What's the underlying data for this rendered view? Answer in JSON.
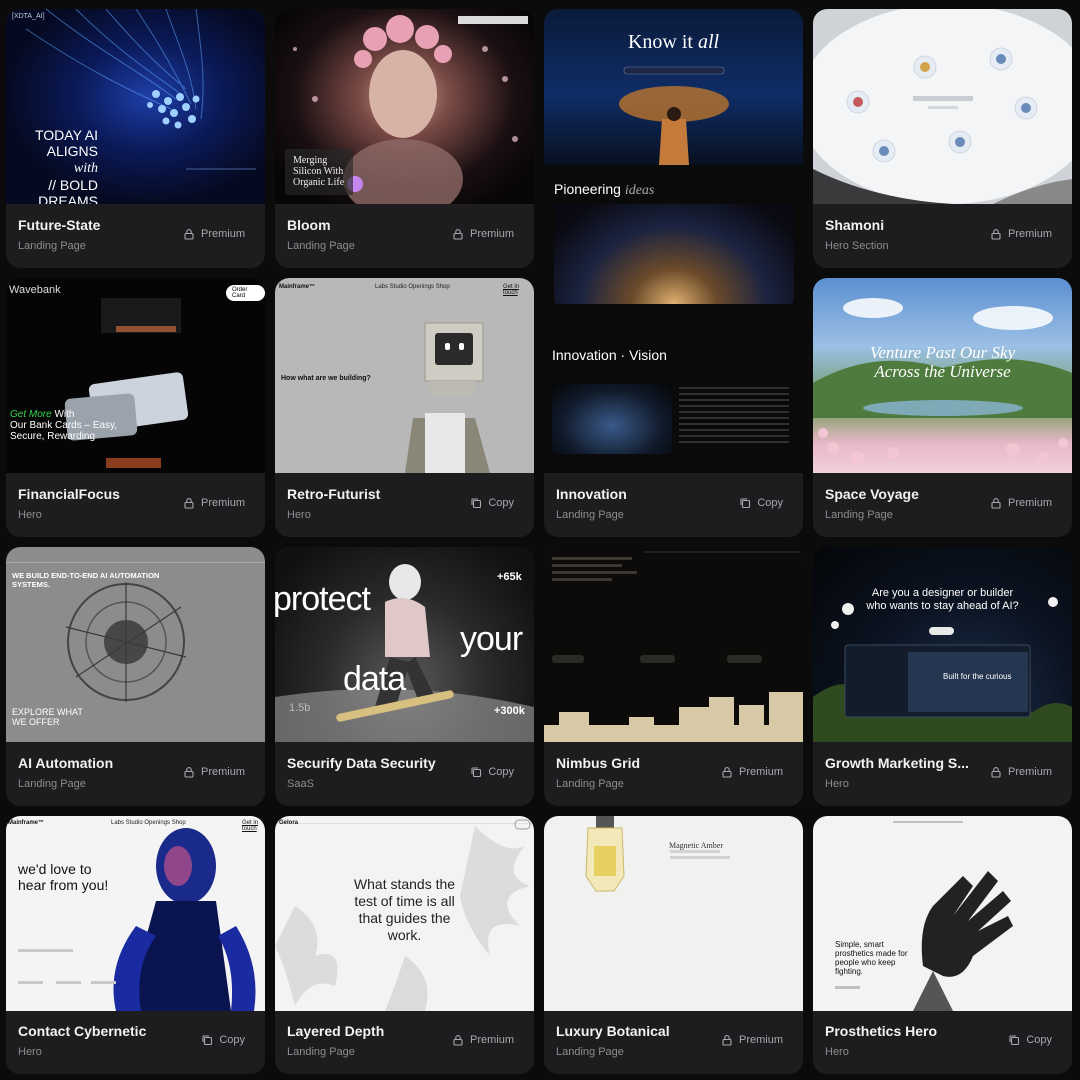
{
  "cards": [
    {
      "title": "Future-State",
      "type": "Landing Page",
      "badge": "Premium",
      "overlay": {
        "l1": "TODAY AI",
        "l2": "ALIGNS",
        "l2b": "with",
        "l3": "// BOLD",
        "l4": "DREAMS",
        "brand": "[XDTA_AI]"
      }
    },
    {
      "title": "Bloom",
      "type": "Landing Page",
      "badge": "Premium",
      "overlay": {
        "l1": "Merging",
        "l2": "Silicon With",
        "l3": "Organic Life"
      }
    },
    {
      "title": "Innovation",
      "type": "Landing Page",
      "badge": "Copy",
      "overlay": {
        "h1": "Know it",
        "h1b": "all",
        "h2": "Pioneering",
        "h2b": "ideas",
        "h3": "Innovation",
        "h3b": "Vision"
      }
    },
    {
      "title": "Shamoni",
      "type": "Hero Section",
      "badge": "Premium"
    },
    {
      "title": "FinancialFocus",
      "type": "Hero",
      "badge": "Premium",
      "overlay": {
        "brand": "Wavebank",
        "l1": "Get More",
        "l1b": "With",
        "l2": "Our Bank Cards – Easy,",
        "l3": "Secure, Rewarding",
        "btn": "Order Card"
      }
    },
    {
      "title": "Retro-Futurist",
      "type": "Hero",
      "badge": "Copy",
      "overlay": {
        "brand": "Mainframe™",
        "nav": "Labs Studio Openings Shop",
        "cta": "Get in touch",
        "q": "How what are we building?"
      }
    },
    {
      "title": "Space Voyage",
      "type": "Landing Page",
      "badge": "Premium",
      "overlay": {
        "l1": "Venture Past Our Sky",
        "l2": "Across the Universe"
      }
    },
    {
      "title": "AI Automation",
      "type": "Landing Page",
      "badge": "Premium",
      "overlay": {
        "l1": "WE BUILD END-TO-END AI AUTOMATION",
        "l2": "SYSTEMS.",
        "l3": "EXPLORE WHAT",
        "l4": "WE OFFER"
      }
    },
    {
      "title": "Securify Data Security",
      "type": "SaaS",
      "badge": "Copy",
      "overlay": {
        "w1": "protect",
        "w2": "your",
        "w3": "data",
        "n1": "+65k",
        "n2": "+300k",
        "n3": "1.5b"
      }
    },
    {
      "title": "Nimbus Grid",
      "type": "Landing Page",
      "badge": "Premium"
    },
    {
      "title": "Growth Marketing S...",
      "type": "Hero",
      "badge": "Premium",
      "overlay": {
        "l1": "Are you a designer or builder",
        "l2": "who wants to stay ahead of AI?",
        "l3": "Built for the curious"
      }
    },
    {
      "title": "Contact Cybernetic",
      "type": "Hero",
      "badge": "Copy",
      "overlay": {
        "brand": "Mainframe™",
        "nav": "Labs Studio Openings Shop",
        "cta": "Get in touch",
        "l1": "we'd love to",
        "l2": "hear from you!"
      }
    },
    {
      "title": "Layered Depth",
      "type": "Landing Page",
      "badge": "Premium",
      "overlay": {
        "brand": "Gelora",
        "l1": "What stands the",
        "l2": "test of time is all",
        "l3": "that guides the",
        "l4": "work."
      }
    },
    {
      "title": "Luxury Botanical",
      "type": "Landing Page",
      "badge": "Premium",
      "overlay": {
        "l1": "Magnetic Amber"
      }
    },
    {
      "title": "Prosthetics Hero",
      "type": "Hero",
      "badge": "Copy",
      "overlay": {
        "l1": "Simple, smart",
        "l2": "prosthetics made for",
        "l3": "people who keep",
        "l4": "fighting."
      }
    }
  ],
  "icons": {
    "premium": "lock-icon",
    "copy": "copy-icon"
  },
  "colors": {
    "background": "#0b0b0c",
    "card": "#1d1d1f",
    "accent_green": "#39d353"
  }
}
